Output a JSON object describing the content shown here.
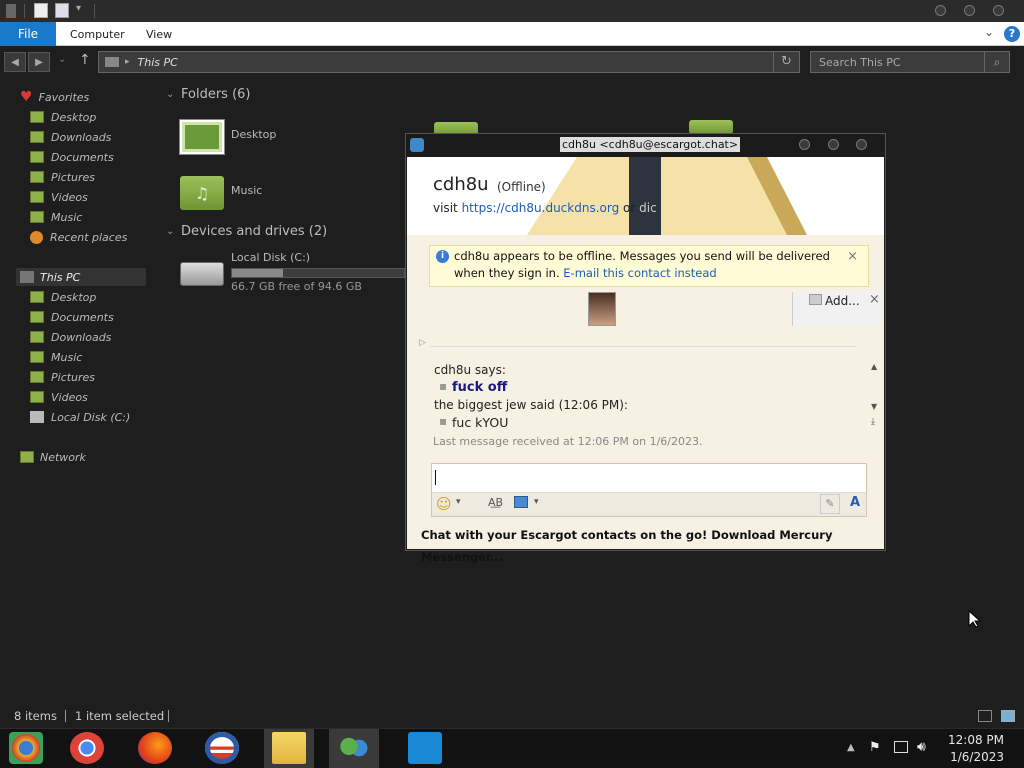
{
  "explorer": {
    "ribbon_tabs": [
      "File",
      "Computer",
      "View"
    ],
    "address": "This PC",
    "search_placeholder": "Search This PC",
    "sidebar": {
      "favorites_label": "Favorites",
      "favorites": [
        "Desktop",
        "Downloads",
        "Documents",
        "Pictures",
        "Videos",
        "Music",
        "Recent places"
      ],
      "thispc_label": "This PC",
      "thispc": [
        "Desktop",
        "Documents",
        "Downloads",
        "Music",
        "Pictures",
        "Videos",
        "Local Disk (C:)"
      ],
      "network_label": "Network"
    },
    "folders_header": "Folders (6)",
    "folders": [
      "Desktop",
      "Music"
    ],
    "drives_header": "Devices and drives (2)",
    "drive": {
      "name": "Local Disk (C:)",
      "free": "66.7 GB free of 94.6 GB",
      "used_fraction": 0.295
    },
    "status": {
      "items": "8 items",
      "selected": "1 item selected"
    }
  },
  "chat": {
    "window_title": "cdh8u <cdh8u@escargot.chat>",
    "contact_name": "cdh8u",
    "contact_status": "(Offline)",
    "visit_prefix": "visit",
    "visit_link": "https://cdh8u.duckdns.org",
    "visit_or": "or",
    "visit_tail": "dic",
    "alert_text": "cdh8u appears to be offline. Messages you send will be delivered when they sign in.",
    "alert_link": "E-mail this contact instead",
    "add_label": "Add...",
    "messages": [
      {
        "sender": "cdh8u says:",
        "text": "fuck off"
      },
      {
        "sender": "the biggest jew said (12:06 PM):",
        "text": "fuc kYOU"
      }
    ],
    "last_received": "Last message received at 12:06 PM on 1/6/2023.",
    "footer_text": "Chat with your Escargot contacts on the go! Download Mercury Messenger...",
    "colors": {
      "accent": "#1979ca",
      "link": "#1a5fb4",
      "sent_msg": "#1a1a80"
    }
  },
  "taskbar": {
    "apps": [
      "chrome-canary",
      "chrome",
      "firefox",
      "obama-logo",
      "file-explorer",
      "messenger",
      "remote-app"
    ],
    "time": "12:08 PM",
    "date": "1/6/2023"
  }
}
